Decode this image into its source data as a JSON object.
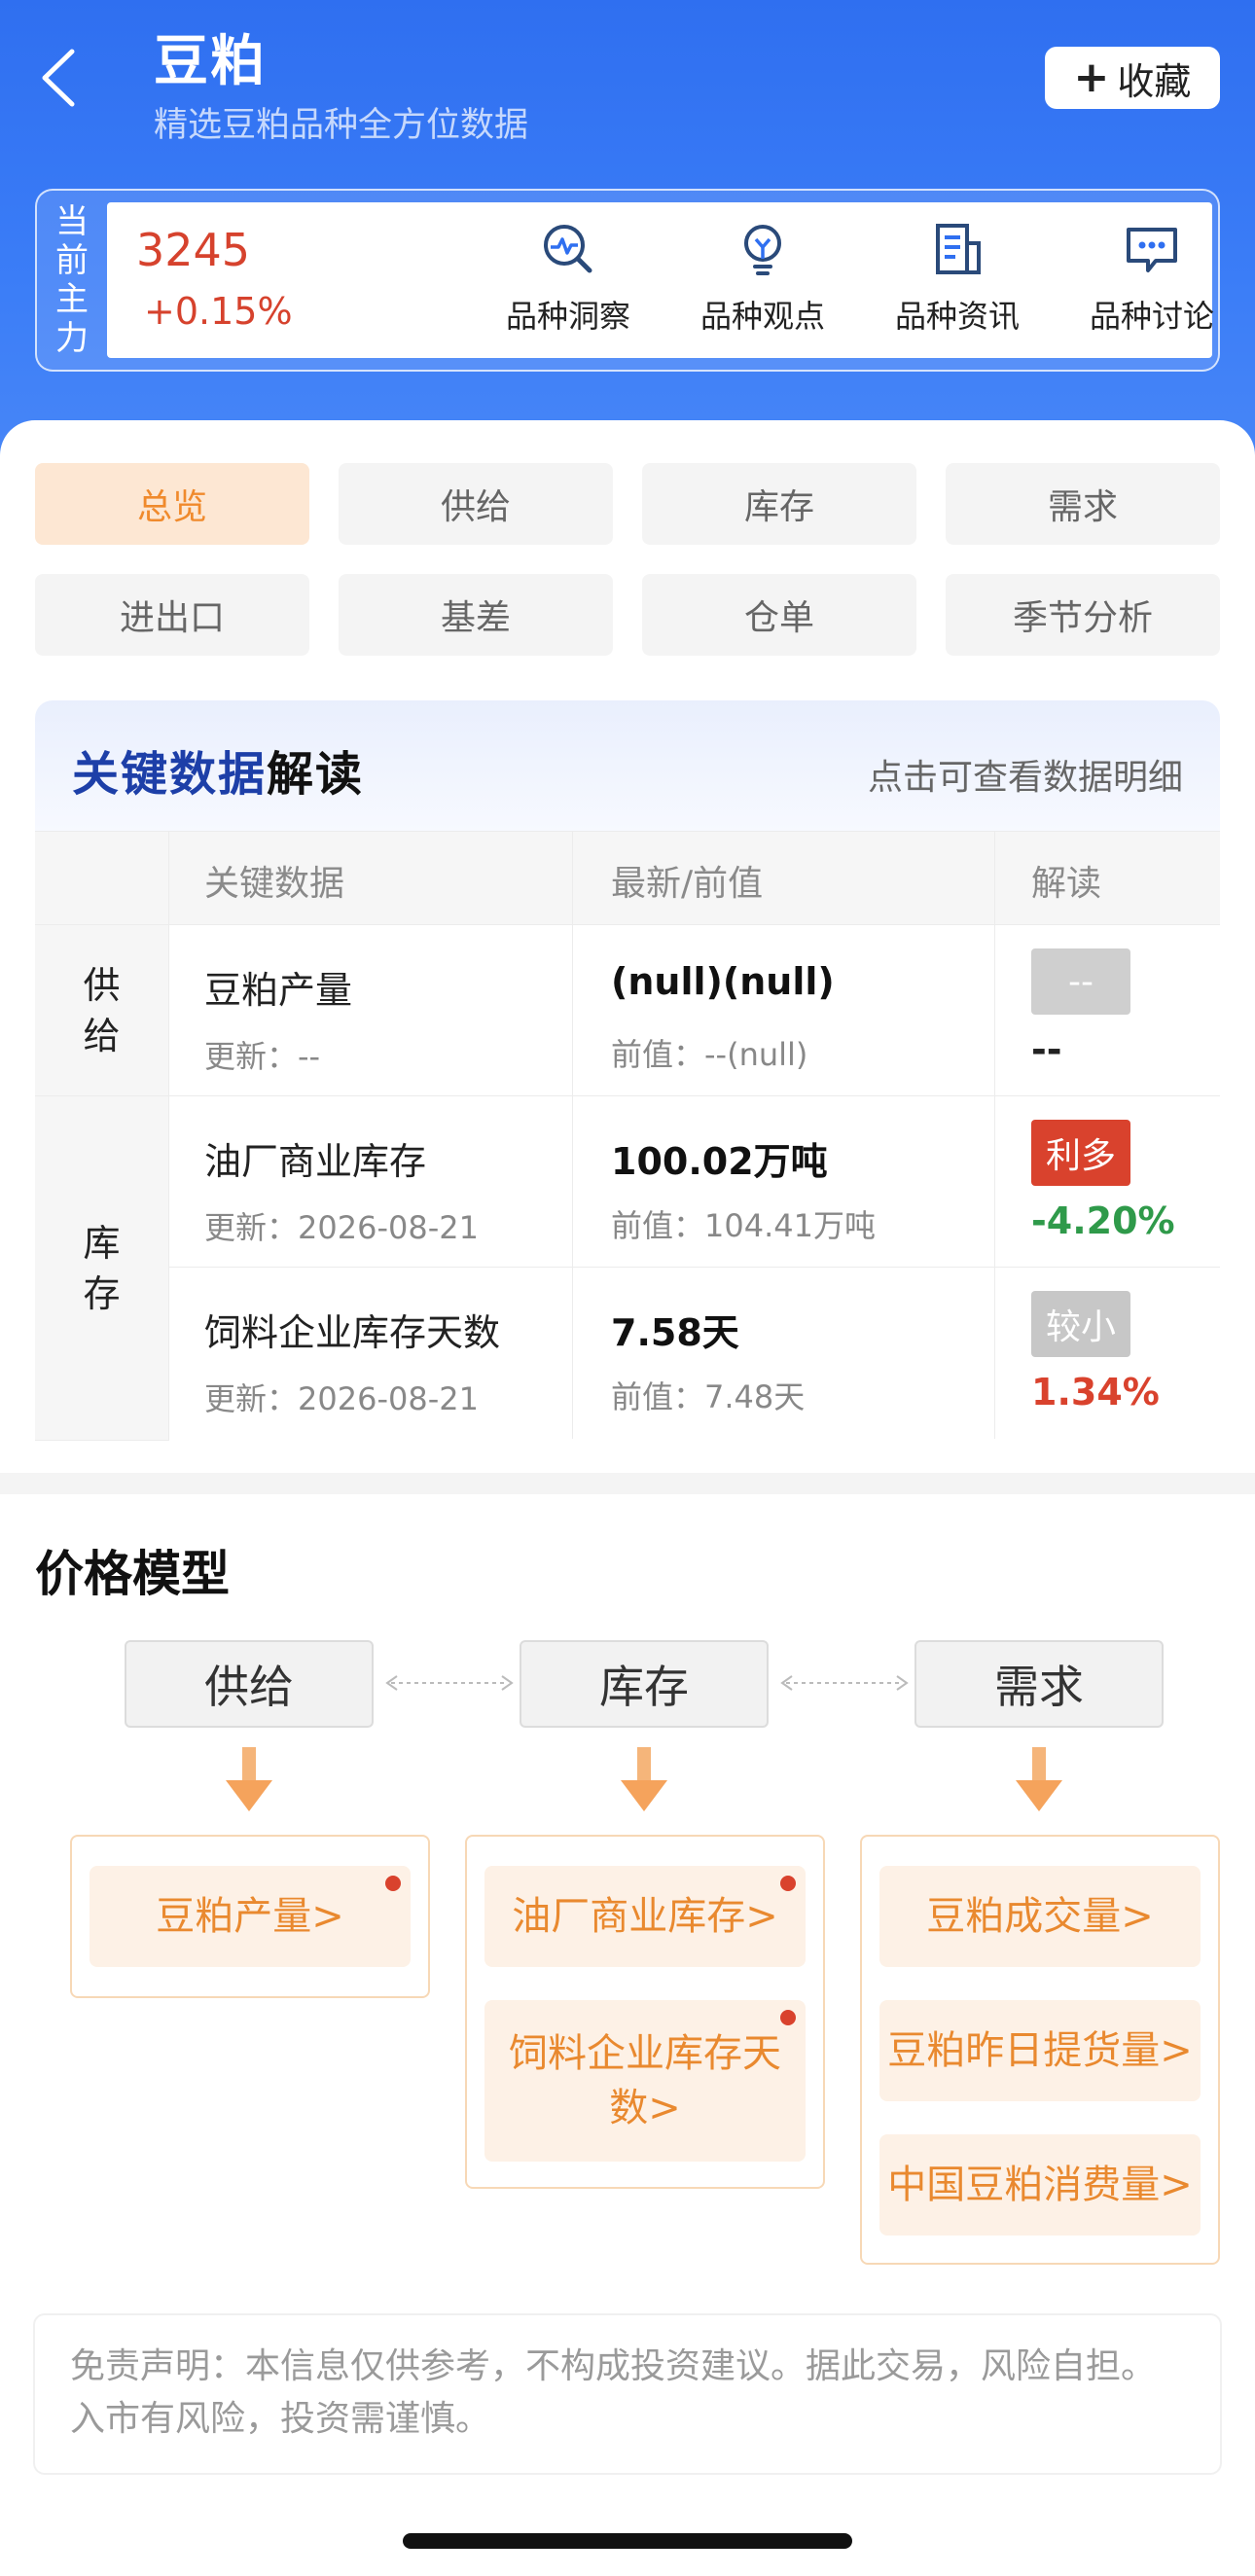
{
  "header": {
    "title": "豆粕",
    "subtitle": "精选豆粕品种全方位数据",
    "fav_label": "收藏"
  },
  "quote": {
    "tag_chars": [
      "当",
      "前",
      "主",
      "力"
    ],
    "price": "3245",
    "change": "+0.15%",
    "actions": [
      {
        "label": "品种洞察",
        "icon": "insight-icon"
      },
      {
        "label": "品种观点",
        "icon": "bulb-icon"
      },
      {
        "label": "品种资讯",
        "icon": "news-icon"
      },
      {
        "label": "品种讨论",
        "icon": "chat-icon"
      }
    ]
  },
  "categories": [
    "总览",
    "供给",
    "库存",
    "需求",
    "进出口",
    "基差",
    "仓单",
    "季节分析"
  ],
  "active_category": "总览",
  "key_data": {
    "title_blue": "关键数据",
    "title_dark": "解读",
    "link": "点击可查看数据明细",
    "headers": [
      "关键数据",
      "最新/前值",
      "解读"
    ],
    "groups": [
      {
        "chars": [
          "供",
          "给"
        ]
      },
      {
        "chars": [
          "库",
          "存"
        ]
      }
    ],
    "rows": [
      {
        "name": "豆粕产量",
        "updated": "更新：--",
        "latest": "(null)(null)",
        "prev": "前值：--(null)",
        "tag": "--",
        "tag_color": "#cfcfcf",
        "pct": "--",
        "pct_color": "#222222"
      },
      {
        "name": "油厂商业库存",
        "updated": "更新：2026-08-21",
        "latest": "100.02万吨",
        "prev": "前值：104.41万吨",
        "tag": "利多",
        "tag_color": "#d9422d",
        "pct": "-4.20%",
        "pct_color": "#2f9a4a"
      },
      {
        "name": "饲料企业库存天数",
        "updated": "更新：2026-08-21",
        "latest": "7.58天",
        "prev": "前值：7.48天",
        "tag": "较小",
        "tag_color": "#c7c7c7",
        "pct": "1.34%",
        "pct_color": "#d9422d"
      }
    ]
  },
  "price_model": {
    "title": "价格模型",
    "nodes": [
      "供给",
      "库存",
      "需求"
    ],
    "supply_items": [
      "豆粕产量>"
    ],
    "stock_items": [
      "油厂商业库存>",
      "饲料企业库存天数>"
    ],
    "demand_items": [
      "豆粕成交量>",
      "豆粕昨日提货量>",
      "中国豆粕消费量>"
    ]
  },
  "disclaimer": "免责声明：本信息仅供参考，不构成投资建议。据此交易，风险自担。入市有风险，投资需谨慎。",
  "colors": {
    "brand_blue": "#2f6ff0",
    "accent_orange": "#f08a2c",
    "up_red": "#d6422d",
    "down_green": "#2f9a4a"
  }
}
